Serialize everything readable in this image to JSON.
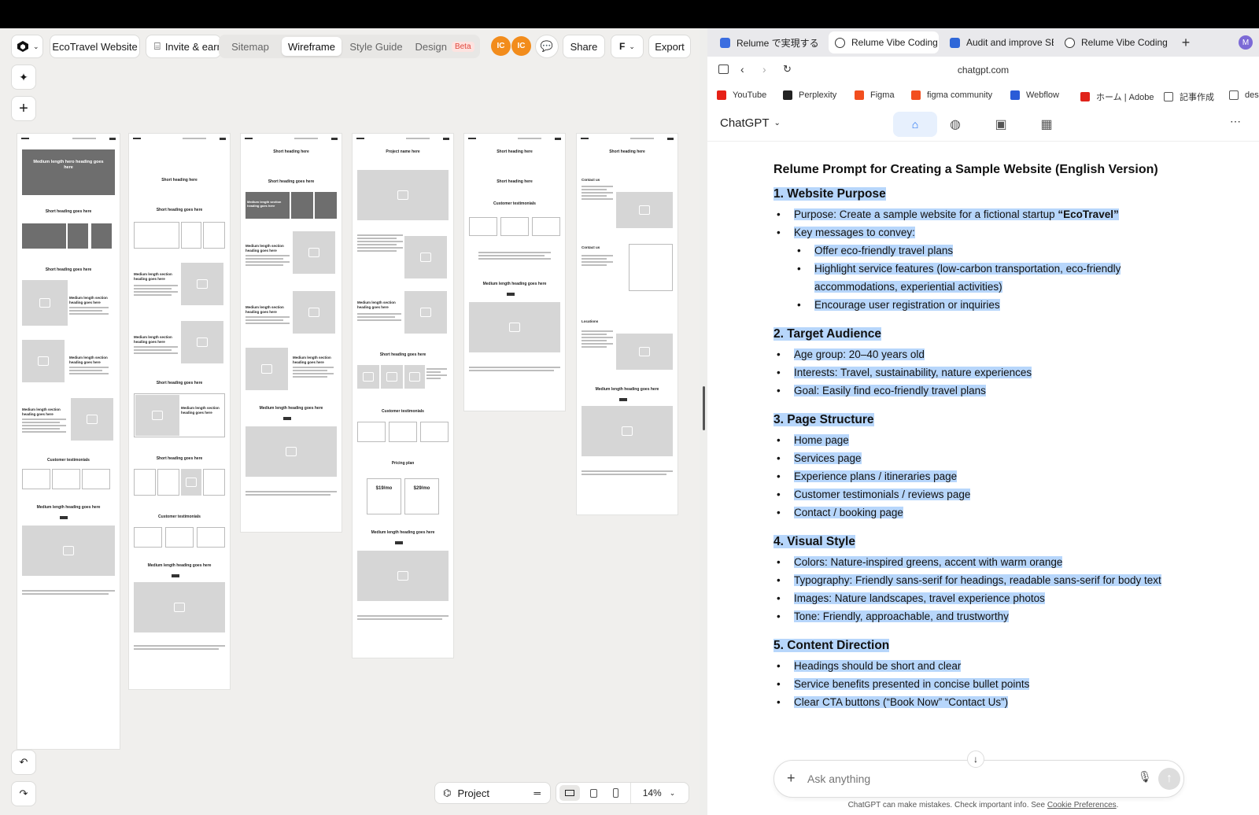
{
  "editor": {
    "project_name": "EcoTravel Website",
    "invite_label": "Invite & earn",
    "view_tabs": [
      "Sitemap",
      "Wireframe",
      "Style Guide",
      "Design"
    ],
    "beta_badge": "Beta",
    "avatars": [
      "IC",
      "IC"
    ],
    "share_label": "Share",
    "export_label": "Export",
    "project_label": "Project",
    "zoom": "14%",
    "active_tab": "Wireframe"
  },
  "wireframes": {
    "p1": {
      "hero": "Medium length hero heading goes here",
      "h1": "Short heading goes here",
      "h2": "Short heading goes here",
      "m1": "Medium length section heading goes here",
      "m2": "Medium length section heading goes here",
      "m3": "Medium length section heading goes here",
      "t": "Customer testimonials",
      "cta": "Medium length heading goes here"
    },
    "p2": {
      "h1": "Short heading here",
      "h2": "Short heading goes here",
      "m1": "Medium length section heading goes here",
      "m2": "Medium length section heading goes here",
      "h3": "Short heading goes here",
      "m3": "Medium length section heading goes here",
      "h4": "Short heading goes here",
      "t": "Customer testimonials",
      "cta": "Medium length heading goes here"
    },
    "p3": {
      "h1": "Short heading here",
      "h2": "Short heading goes here",
      "d1": "Medium length section heading goes here",
      "m1": "Medium length section heading goes here",
      "m2": "Medium length section heading goes here",
      "m3": "Medium length section heading goes here",
      "cta": "Medium length heading goes here"
    },
    "p4": {
      "h1": "Project name here",
      "m1": "Medium length section heading goes here",
      "h2": "Short heading goes here",
      "t": "Customer testimonials",
      "pp": "Pricing plan",
      "price1": "$19/mo",
      "price2": "$29/mo",
      "cta": "Medium length heading goes here"
    },
    "p5": {
      "h1": "Short heading here",
      "h2": "Short heading here",
      "t": "Customer testimonials",
      "cta": "Medium length heading goes here"
    },
    "p6": {
      "h1": "Short heading here",
      "c1": "Contact us",
      "c2": "Contact us",
      "loc": "Locations",
      "cta": "Medium length heading goes here"
    }
  },
  "browser": {
    "tabs": [
      "Relume で実現する「Vi",
      "Relume Vibe Coding",
      "Audit and improve SE",
      "Relume Vibe Coding"
    ],
    "active_tab_index": 1,
    "profile_initial": "M",
    "url": "chatgpt.com",
    "bookmarks": [
      "YouTube",
      "Perplexity",
      "Figma",
      "figma community",
      "Webflow",
      "ホーム | Adobe",
      "記事作成",
      "des"
    ]
  },
  "chatgpt": {
    "model_label": "ChatGPT",
    "title": "Relume Prompt for Creating a Sample Website (English Version)",
    "sections": [
      {
        "heading": "1. Website Purpose",
        "items": [
          {
            "text": "Purpose: Create a sample website for a fictional startup ",
            "bold": "“EcoTravel”",
            "level": 1
          },
          {
            "text": "Key messages to convey:",
            "level": 1
          },
          {
            "text": "Offer eco-friendly travel plans",
            "level": 2
          },
          {
            "text": "Highlight service features (low-carbon transportation, eco-friendly accommodations, experiential activities)",
            "level": 2
          },
          {
            "text": "Encourage user registration or inquiries",
            "level": 2
          }
        ]
      },
      {
        "heading": "2. Target Audience",
        "items": [
          {
            "text": "Age group: 20–40 years old",
            "level": 1
          },
          {
            "text": "Interests: Travel, sustainability, nature experiences",
            "level": 1
          },
          {
            "text": "Goal: Easily find eco-friendly travel plans",
            "level": 1
          }
        ]
      },
      {
        "heading": "3. Page Structure",
        "items": [
          {
            "text": "Home page",
            "level": 1
          },
          {
            "text": "Services page",
            "level": 1
          },
          {
            "text": "Experience plans / itineraries page",
            "level": 1
          },
          {
            "text": "Customer testimonials / reviews page",
            "level": 1
          },
          {
            "text": "Contact / booking page",
            "level": 1
          }
        ]
      },
      {
        "heading": "4. Visual Style",
        "items": [
          {
            "text": "Colors: Nature-inspired greens, accent with warm orange",
            "level": 1
          },
          {
            "text": "Typography: Friendly sans-serif for headings, readable sans-serif for body text",
            "level": 1
          },
          {
            "text": "Images: Nature landscapes, travel experience photos",
            "level": 1
          },
          {
            "text": "Tone: Friendly, approachable, and trustworthy",
            "level": 1
          }
        ]
      },
      {
        "heading": "5. Content Direction",
        "items": [
          {
            "text": "Headings should be short and clear",
            "level": 1
          },
          {
            "text": "Service benefits presented in concise bullet points",
            "level": 1
          },
          {
            "text": "Clear CTA buttons (“Book Now” “Contact Us”)",
            "level": 1
          }
        ]
      }
    ],
    "composer_placeholder": "Ask anything",
    "disclaimer": "ChatGPT can make mistakes. Check important info. See ",
    "disclaimer_link": "Cookie Preferences",
    "disclaimer_end": "."
  },
  "colors": {
    "accent_orange": "#f28c1c",
    "selection": "#b7d6fb",
    "beta_red": "#e0473c"
  }
}
